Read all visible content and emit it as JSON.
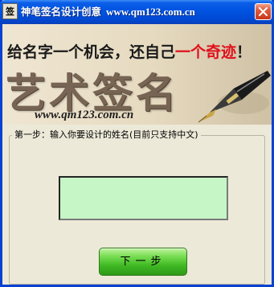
{
  "window": {
    "icon_text": "签",
    "title": "神笔签名设计创意",
    "title_url": "www.qm123.com.cn"
  },
  "banner": {
    "slogan_black": "给名字一个机会，还自己",
    "slogan_red": "一个奇迹",
    "slogan_end": "！",
    "title": "艺术签名",
    "url": "www.qm123.com.cn"
  },
  "form": {
    "legend": "第一步：输入你要设计的姓名(目前只支持中文)",
    "name_value": "",
    "next_label": "下一步"
  },
  "colors": {
    "titlebar": "#0053e0",
    "input_bg": "#c6f5c6",
    "button_green": "#3fb823",
    "slogan_red": "#e0101c"
  },
  "icons": [
    "app-icon",
    "close-icon",
    "fountain-pen-icon"
  ]
}
